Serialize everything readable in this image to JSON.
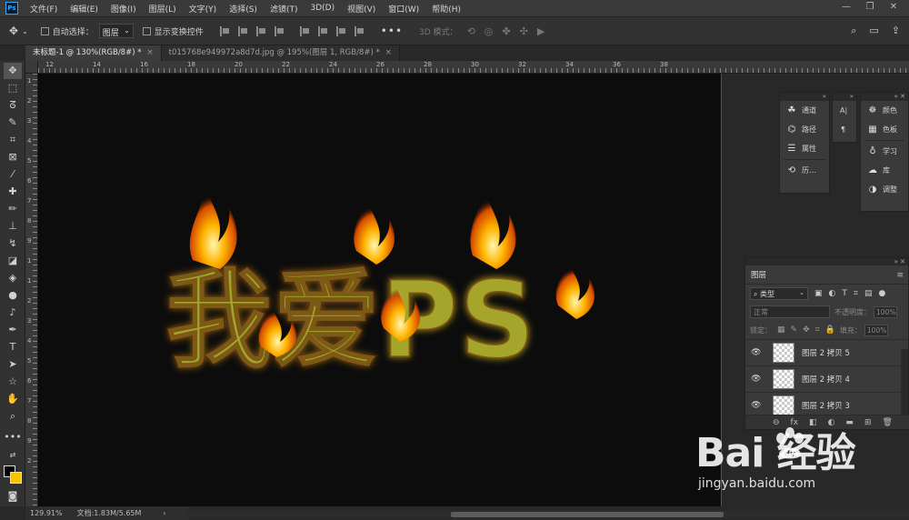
{
  "app": {
    "logo": "Ps",
    "menus": [
      "文件(F)",
      "编辑(E)",
      "图像(I)",
      "图层(L)",
      "文字(Y)",
      "选择(S)",
      "滤镜(T)",
      "3D(D)",
      "视图(V)",
      "窗口(W)",
      "帮助(H)"
    ],
    "window_controls": [
      "—",
      "❐",
      "✕"
    ]
  },
  "options": {
    "auto_select_label": "自动选择：",
    "auto_select_value": "图层",
    "show_transform_label": "显示变换控件",
    "more": "•••",
    "mode_3d_label": "3D 模式："
  },
  "tabs": [
    {
      "label": "未标题-1 @ 130%(RGB/8#) *",
      "close": "×"
    },
    {
      "label": "t015768e949972a8d7d.jpg @ 195%(图层 1, RGB/8#) *",
      "close": "×"
    }
  ],
  "rulers": {
    "top": [
      "12",
      "14",
      "16",
      "18",
      "20",
      "22",
      "24",
      "26",
      "28",
      "30",
      "32",
      "34",
      "36",
      "38"
    ],
    "left": [
      "1",
      "2",
      "3",
      "4",
      "5",
      "6",
      "7",
      "8",
      "9",
      "1",
      "1",
      "2",
      "3",
      "4",
      "5",
      "6",
      "7",
      "8",
      "9",
      "2"
    ]
  },
  "canvas": {
    "text": "我爱PS",
    "fill_color": "#a4a52a",
    "glow_color": "#f5b800",
    "background": "#0c0c0c"
  },
  "status": {
    "zoom": "129.91%",
    "doc": "文档:1.83M/5.65M",
    "arrow": "›"
  },
  "panels": {
    "group_a": {
      "channels": "通道",
      "paths": "路径",
      "properties": "属性",
      "history": "历…"
    },
    "group_c": {
      "color": "颜色",
      "swatches": "色板",
      "learn": "学习",
      "libraries": "库",
      "adjustments": "调整"
    }
  },
  "layers": {
    "tab": "图层",
    "kind": "类型",
    "blend": "正常",
    "opacity_label": "不透明度：",
    "opacity": "100%",
    "lock_label": "锁定：",
    "fill_label": "填充：",
    "fill": "100%",
    "items": [
      {
        "name": "图层 2 拷贝 5"
      },
      {
        "name": "图层 2 拷贝 4"
      },
      {
        "name": "图层 2 拷贝 3"
      }
    ],
    "foot": [
      "⊖",
      "fx",
      "◧",
      "◐",
      "▬",
      "⊞",
      "🗑"
    ]
  },
  "watermark": {
    "brand": "Bai  经验",
    "url": "jingyan.baidu.com"
  },
  "colors": {
    "foreground": "#000000",
    "background": "#f5c400"
  }
}
